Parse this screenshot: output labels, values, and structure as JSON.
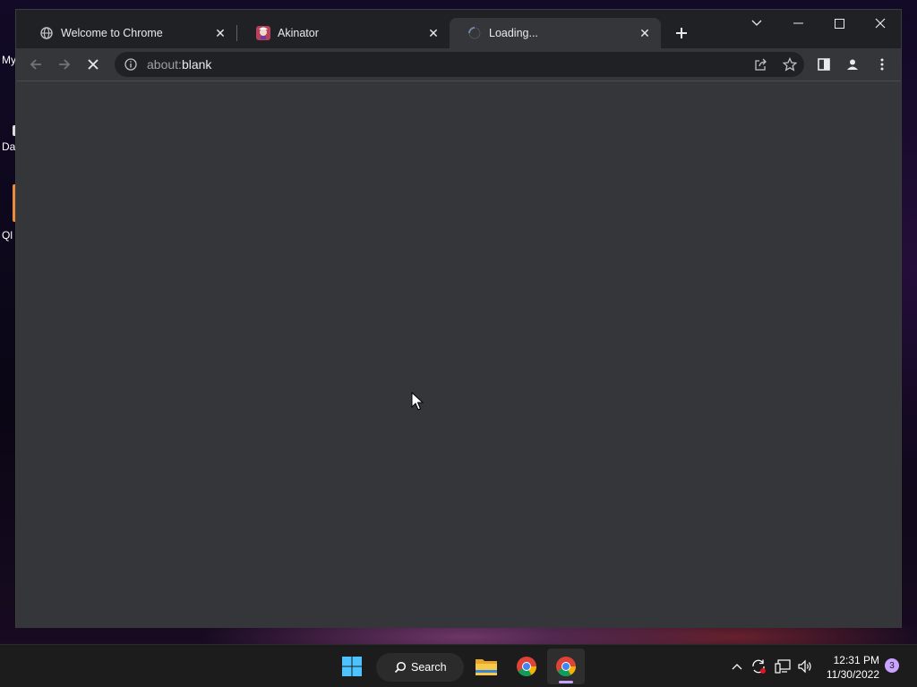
{
  "desktop": {
    "icons": [
      {
        "label": "My",
        "icon": "this-pc-icon"
      },
      {
        "label": "Da",
        "icon": "data-folder-icon"
      },
      {
        "label": "Ql",
        "icon": "app-shortcut-icon"
      }
    ]
  },
  "browser": {
    "tabs": [
      {
        "title": "Welcome to Chrome",
        "favicon": "globe-icon",
        "active": false
      },
      {
        "title": "Akinator",
        "favicon": "akinator-genie-icon",
        "active": false
      },
      {
        "title": "Loading...",
        "favicon": "loading-spinner-icon",
        "active": true
      }
    ],
    "new_tab_label": "+",
    "address_bar": {
      "scheme": "about:",
      "rest": "blank",
      "state": "loading"
    },
    "toolbar_icons": [
      "back-arrow-icon",
      "forward-arrow-icon",
      "stop-loading-icon",
      "site-info-icon",
      "share-icon",
      "bookmark-star-icon",
      "side-panel-icon",
      "profile-icon",
      "more-menu-icon"
    ],
    "window_controls": [
      "tab-search-icon",
      "minimize-icon",
      "maximize-icon",
      "close-icon"
    ],
    "colors": {
      "frame": "#202124",
      "toolbar": "#35363a",
      "content": "#35363a",
      "omnibox": "#202124"
    }
  },
  "taskbar": {
    "search_label": "Search",
    "pinned": [
      "windows-start-icon",
      "search-icon",
      "file-explorer-icon",
      "chrome-icon",
      "chrome-active-icon"
    ],
    "tray_icons": [
      "show-hidden-icons-chevron",
      "sync-icon",
      "network-icon",
      "volume-icon"
    ],
    "time": "12:31 PM",
    "date": "11/30/2022",
    "notification_count": "3"
  }
}
